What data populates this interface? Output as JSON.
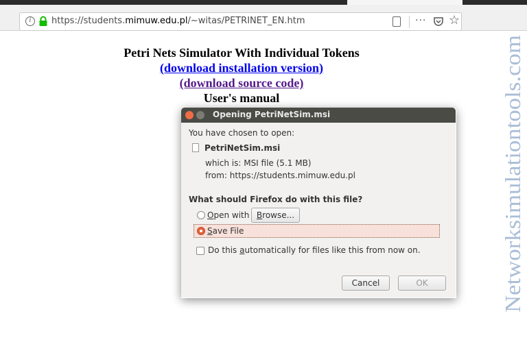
{
  "browser": {
    "url_prefix": "https://students.",
    "url_domain": "mimuw.edu.pl",
    "url_path": "/~witas/PETRINET_EN.htm",
    "more_label": "···"
  },
  "page": {
    "title": "Petri Nets Simulator With Individual Tokens",
    "link_install": "(download installation version)",
    "link_source": "(download source code)",
    "manual": "User's manual",
    "watermark": "Networksimulationtools.com"
  },
  "dialog": {
    "title": "Opening PetriNetSim.msi",
    "intro": "You have chosen to open:",
    "filename": "PetriNetSim.msi",
    "which_is": "which is:  MSI file (5.1 MB)",
    "from": "from:  https://students.mimuw.edu.pl",
    "question": "What should Firefox do with this file?",
    "open_with_pre": "",
    "open_with_ul": "O",
    "open_with_post": "pen with",
    "browse_ul": "B",
    "browse_post": "rowse...",
    "save_ul": "S",
    "save_post": "ave File",
    "auto_pre": "Do this ",
    "auto_ul": "a",
    "auto_post": "utomatically for files like this from now on.",
    "cancel_label": "Cancel",
    "ok_label": "OK",
    "selected_option": "save"
  },
  "colors": {
    "accent": "#e0623b",
    "link": "#0000ee",
    "visited": "#551a8b",
    "watermark": "#a9bdd6"
  }
}
